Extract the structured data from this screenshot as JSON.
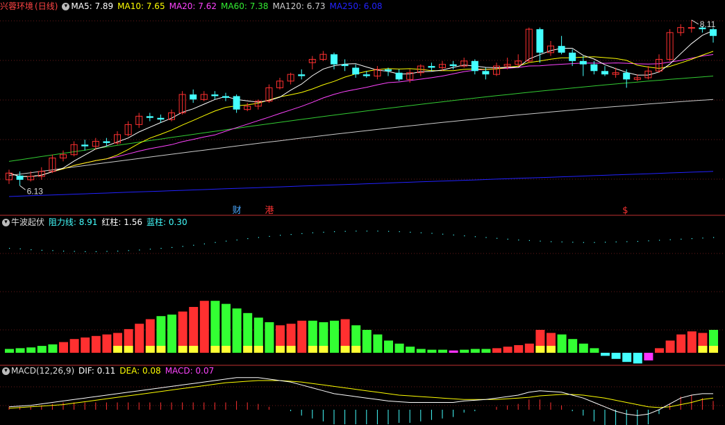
{
  "main": {
    "stock_name": "兴蓉环境",
    "period": "(日线)",
    "ma": [
      {
        "label": "MA5:",
        "value": "7.89",
        "color": "#ffffff"
      },
      {
        "label": "MA10:",
        "value": "7.65",
        "color": "#ffff00"
      },
      {
        "label": "MA20:",
        "value": "7.62",
        "color": "#ff44ff"
      },
      {
        "label": "MA60:",
        "value": "7.38",
        "color": "#33ee33"
      },
      {
        "label": "MA120:",
        "value": "6.73",
        "color": "#cccccc"
      },
      {
        "label": "MA250:",
        "value": "6.08",
        "color": "#2222ff"
      }
    ],
    "high_label": "8.11",
    "low_label": "6.13",
    "markers": [
      {
        "text": "财",
        "color": "#4aa8ff",
        "index": 21
      },
      {
        "text": "港",
        "color": "#ff3333",
        "index": 24
      },
      {
        "text": "$",
        "color": "#ff3333",
        "index": 57
      }
    ]
  },
  "indicator": {
    "name": "牛波起伏",
    "fields": [
      {
        "label": "阻力线:",
        "value": "8.91",
        "color": "#44ffff"
      },
      {
        "label": "红柱:",
        "value": "1.56",
        "color": "#ffffff"
      },
      {
        "label": "蓝柱:",
        "value": "0.30",
        "color": "#44ffff"
      }
    ]
  },
  "macd": {
    "name": "MACD(12,26,9)",
    "fields": [
      {
        "label": "DIF:",
        "value": "0.11",
        "color": "#ffffff"
      },
      {
        "label": "DEA:",
        "value": "0.08",
        "color": "#ffff00"
      },
      {
        "label": "MACD:",
        "value": "0.07",
        "color": "#ff44ff"
      }
    ]
  },
  "chart_data": {
    "type": "candlestick",
    "price_range": [
      5.9,
      8.2
    ],
    "candles": [
      [
        6.2,
        6.28,
        6.32,
        6.15
      ],
      [
        6.25,
        6.2,
        6.3,
        6.13
      ],
      [
        6.2,
        6.24,
        6.3,
        6.18
      ],
      [
        6.24,
        6.3,
        6.35,
        6.2
      ],
      [
        6.3,
        6.46,
        6.5,
        6.28
      ],
      [
        6.46,
        6.5,
        6.55,
        6.42
      ],
      [
        6.5,
        6.62,
        6.66,
        6.48
      ],
      [
        6.62,
        6.6,
        6.68,
        6.55
      ],
      [
        6.6,
        6.66,
        6.7,
        6.56
      ],
      [
        6.66,
        6.64,
        6.7,
        6.6
      ],
      [
        6.64,
        6.74,
        6.78,
        6.62
      ],
      [
        6.74,
        6.86,
        6.9,
        6.72
      ],
      [
        6.86,
        6.96,
        7.0,
        6.82
      ],
      [
        6.96,
        6.94,
        7.0,
        6.9
      ],
      [
        6.94,
        6.92,
        6.98,
        6.88
      ],
      [
        6.92,
        7.0,
        7.04,
        6.9
      ],
      [
        7.0,
        7.22,
        7.26,
        6.98
      ],
      [
        7.22,
        7.16,
        7.28,
        7.12
      ],
      [
        7.16,
        7.22,
        7.26,
        7.14
      ],
      [
        7.22,
        7.2,
        7.26,
        7.16
      ],
      [
        7.2,
        7.18,
        7.24,
        7.14
      ],
      [
        7.2,
        7.04,
        7.22,
        7.0
      ],
      [
        7.04,
        7.08,
        7.12,
        7.02
      ],
      [
        7.08,
        7.14,
        7.16,
        7.04
      ],
      [
        7.14,
        7.3,
        7.34,
        7.12
      ],
      [
        7.3,
        7.38,
        7.42,
        7.28
      ],
      [
        7.38,
        7.46,
        7.48,
        7.34
      ],
      [
        7.46,
        7.44,
        7.52,
        7.4
      ],
      [
        7.6,
        7.64,
        7.68,
        7.52
      ],
      [
        7.64,
        7.7,
        7.74,
        7.62
      ],
      [
        7.7,
        7.58,
        7.72,
        7.52
      ],
      [
        7.58,
        7.56,
        7.64,
        7.5
      ],
      [
        7.54,
        7.46,
        7.58,
        7.42
      ],
      [
        7.46,
        7.44,
        7.5,
        7.42
      ],
      [
        7.44,
        7.52,
        7.56,
        7.4
      ],
      [
        7.52,
        7.5,
        7.54,
        7.44
      ],
      [
        7.48,
        7.4,
        7.52,
        7.38
      ],
      [
        7.4,
        7.48,
        7.52,
        7.36
      ],
      [
        7.48,
        7.56,
        7.58,
        7.44
      ],
      [
        7.56,
        7.54,
        7.6,
        7.5
      ],
      [
        7.54,
        7.58,
        7.62,
        7.5
      ],
      [
        7.58,
        7.56,
        7.62,
        7.52
      ],
      [
        7.56,
        7.62,
        7.66,
        7.54
      ],
      [
        7.62,
        7.5,
        7.64,
        7.46
      ],
      [
        7.5,
        7.46,
        7.54,
        7.4
      ],
      [
        7.46,
        7.56,
        7.6,
        7.44
      ],
      [
        7.56,
        7.58,
        7.66,
        7.52
      ],
      [
        7.58,
        7.62,
        7.7,
        7.56
      ],
      [
        7.62,
        8.0,
        8.02,
        7.6
      ],
      [
        8.0,
        7.72,
        8.02,
        7.6
      ],
      [
        7.72,
        7.8,
        7.86,
        7.68
      ],
      [
        7.8,
        7.72,
        7.92,
        7.7
      ],
      [
        7.72,
        7.62,
        7.76,
        7.56
      ],
      [
        7.62,
        7.58,
        7.68,
        7.44
      ],
      [
        7.58,
        7.5,
        7.62,
        7.46
      ],
      [
        7.5,
        7.46,
        7.56,
        7.44
      ],
      [
        7.46,
        7.48,
        7.54,
        7.42
      ],
      [
        7.48,
        7.4,
        7.52,
        7.3
      ],
      [
        7.4,
        7.42,
        7.46,
        7.38
      ],
      [
        7.42,
        7.5,
        7.56,
        7.4
      ],
      [
        7.5,
        7.64,
        7.7,
        7.48
      ],
      [
        7.64,
        7.96,
        8.0,
        7.62
      ],
      [
        7.96,
        8.02,
        8.06,
        7.92
      ],
      [
        8.02,
        8.02,
        8.11,
        7.96
      ],
      [
        8.02,
        8.0,
        8.04,
        7.96
      ],
      [
        8.0,
        7.92,
        8.02,
        7.84
      ]
    ],
    "ma250": [
      6.0,
      6.3
    ],
    "ma120": [
      6.25,
      7.16
    ],
    "ma60": [
      6.42,
      7.44
    ],
    "indicator_resistance": [
      7.5,
      7.48,
      7.45,
      7.43,
      7.42,
      7.4,
      7.39,
      7.38,
      7.38,
      7.39,
      7.4,
      7.42,
      7.44,
      7.47,
      7.5,
      7.53,
      7.57,
      7.61,
      7.66,
      7.71,
      7.76,
      7.8,
      7.85,
      7.89,
      7.93,
      7.97,
      8.0,
      8.03,
      8.06,
      8.08,
      8.1,
      8.11,
      8.12,
      8.12,
      8.12,
      8.11,
      8.1,
      8.08,
      8.06,
      8.04,
      8.01,
      7.98,
      7.95,
      7.92,
      7.89,
      7.86,
      7.83,
      7.8,
      7.78,
      7.76,
      7.74,
      7.73,
      7.72,
      7.71,
      7.71,
      7.72,
      7.73,
      7.74,
      7.75,
      7.77,
      7.79,
      7.81,
      7.83,
      7.85,
      7.87,
      7.89
    ],
    "indicator_bars": [
      [
        0.05,
        "g"
      ],
      [
        0.06,
        "g"
      ],
      [
        0.07,
        "g"
      ],
      [
        0.09,
        "g"
      ],
      [
        0.11,
        "g"
      ],
      [
        0.14,
        "r"
      ],
      [
        0.18,
        "r"
      ],
      [
        0.2,
        "r"
      ],
      [
        0.22,
        "r"
      ],
      [
        0.24,
        "r"
      ],
      [
        0.26,
        "r"
      ],
      [
        0.31,
        "r"
      ],
      [
        0.38,
        "r"
      ],
      [
        0.44,
        "r"
      ],
      [
        0.48,
        "g"
      ],
      [
        0.5,
        "g"
      ],
      [
        0.54,
        "r"
      ],
      [
        0.6,
        "r"
      ],
      [
        0.68,
        "r"
      ],
      [
        0.68,
        "g"
      ],
      [
        0.64,
        "g"
      ],
      [
        0.58,
        "g"
      ],
      [
        0.52,
        "g"
      ],
      [
        0.46,
        "g"
      ],
      [
        0.4,
        "g"
      ],
      [
        0.36,
        "r"
      ],
      [
        0.38,
        "r"
      ],
      [
        0.42,
        "r"
      ],
      [
        0.42,
        "g"
      ],
      [
        0.4,
        "g"
      ],
      [
        0.42,
        "g"
      ],
      [
        0.44,
        "r"
      ],
      [
        0.36,
        "g"
      ],
      [
        0.3,
        "g"
      ],
      [
        0.24,
        "g"
      ],
      [
        0.16,
        "g"
      ],
      [
        0.12,
        "g"
      ],
      [
        0.08,
        "g"
      ],
      [
        0.05,
        "g"
      ],
      [
        0.04,
        "g"
      ],
      [
        0.04,
        "g"
      ],
      [
        0.03,
        "m"
      ],
      [
        0.04,
        "g"
      ],
      [
        0.05,
        "g"
      ],
      [
        0.05,
        "g"
      ],
      [
        0.06,
        "r"
      ],
      [
        0.08,
        "r"
      ],
      [
        0.1,
        "r"
      ],
      [
        0.12,
        "r"
      ],
      [
        0.3,
        "r"
      ],
      [
        0.26,
        "r"
      ],
      [
        0.24,
        "g"
      ],
      [
        0.18,
        "g"
      ],
      [
        0.12,
        "g"
      ],
      [
        0.06,
        "g"
      ],
      [
        -0.04,
        "c"
      ],
      [
        -0.08,
        "c"
      ],
      [
        -0.12,
        "c"
      ],
      [
        -0.14,
        "c"
      ],
      [
        -0.1,
        "m"
      ],
      [
        0.06,
        "r"
      ],
      [
        0.16,
        "r"
      ],
      [
        0.24,
        "r"
      ],
      [
        0.28,
        "r"
      ],
      [
        0.26,
        "r"
      ],
      [
        0.3,
        "g"
      ]
    ],
    "macd_dif": [
      0.02,
      0.025,
      0.03,
      0.04,
      0.05,
      0.06,
      0.07,
      0.08,
      0.09,
      0.1,
      0.11,
      0.12,
      0.13,
      0.14,
      0.15,
      0.16,
      0.17,
      0.18,
      0.19,
      0.2,
      0.21,
      0.22,
      0.22,
      0.22,
      0.21,
      0.2,
      0.19,
      0.17,
      0.15,
      0.13,
      0.11,
      0.1,
      0.09,
      0.08,
      0.07,
      0.06,
      0.055,
      0.05,
      0.05,
      0.05,
      0.05,
      0.05,
      0.06,
      0.065,
      0.07,
      0.08,
      0.09,
      0.1,
      0.12,
      0.13,
      0.125,
      0.12,
      0.1,
      0.08,
      0.05,
      0.02,
      -0.01,
      -0.03,
      -0.04,
      -0.03,
      0.0,
      0.04,
      0.08,
      0.1,
      0.11,
      0.11
    ],
    "macd_dea": [
      0.01,
      0.015,
      0.02,
      0.025,
      0.03,
      0.035,
      0.045,
      0.055,
      0.065,
      0.075,
      0.085,
      0.095,
      0.105,
      0.115,
      0.125,
      0.135,
      0.145,
      0.155,
      0.165,
      0.175,
      0.185,
      0.19,
      0.195,
      0.2,
      0.2,
      0.2,
      0.195,
      0.19,
      0.18,
      0.17,
      0.16,
      0.15,
      0.14,
      0.13,
      0.12,
      0.11,
      0.1,
      0.095,
      0.09,
      0.085,
      0.08,
      0.075,
      0.07,
      0.07,
      0.07,
      0.07,
      0.075,
      0.08,
      0.085,
      0.095,
      0.1,
      0.105,
      0.105,
      0.1,
      0.09,
      0.08,
      0.065,
      0.05,
      0.035,
      0.02,
      0.015,
      0.02,
      0.035,
      0.05,
      0.07,
      0.08
    ],
    "macd_hist": [
      0.02,
      0.02,
      0.02,
      0.03,
      0.04,
      0.05,
      0.05,
      0.05,
      0.05,
      0.05,
      0.05,
      0.05,
      0.05,
      0.05,
      0.05,
      0.05,
      0.05,
      0.05,
      0.05,
      0.05,
      0.05,
      0.06,
      0.05,
      0.04,
      0.02,
      0.0,
      -0.01,
      -0.04,
      -0.06,
      -0.08,
      -0.1,
      -0.1,
      -0.1,
      -0.1,
      -0.1,
      -0.1,
      -0.09,
      -0.09,
      -0.08,
      -0.07,
      -0.06,
      -0.05,
      -0.02,
      -0.01,
      0.0,
      0.02,
      0.03,
      0.04,
      0.07,
      0.07,
      0.05,
      0.03,
      -0.01,
      -0.04,
      -0.08,
      -0.12,
      -0.15,
      -0.16,
      -0.15,
      -0.1,
      -0.03,
      0.04,
      0.09,
      0.1,
      0.08,
      0.06
    ]
  }
}
